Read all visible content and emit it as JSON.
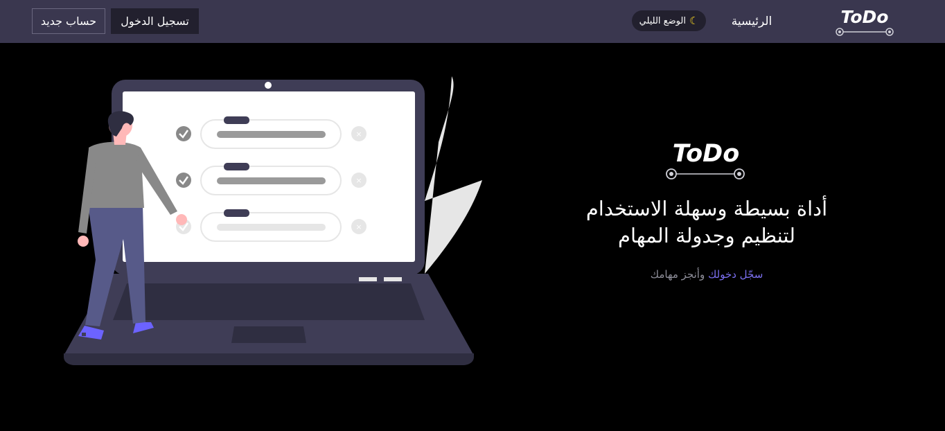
{
  "brand": {
    "logo_text": "ToDo"
  },
  "nav": {
    "home_label": "الرئيسية",
    "dark_mode_label": "الوضع الليلي",
    "login_label": "تسجيل الدخول",
    "register_label": "حساب جديد"
  },
  "hero": {
    "logo_text": "ToDo",
    "title_line1": "أداة بسيطة وسهلة الاستخدام",
    "title_line2": "لتنظيم وجدولة المهام",
    "login_link": "سجّل دخولك",
    "subtitle_rest": "وأنجز مهامك"
  },
  "colors": {
    "navbar": "#3a374f",
    "background": "#000000",
    "link": "#7b6ff0",
    "moon": "#f5d322"
  },
  "icons": {
    "dark_mode": "moon-icon"
  }
}
